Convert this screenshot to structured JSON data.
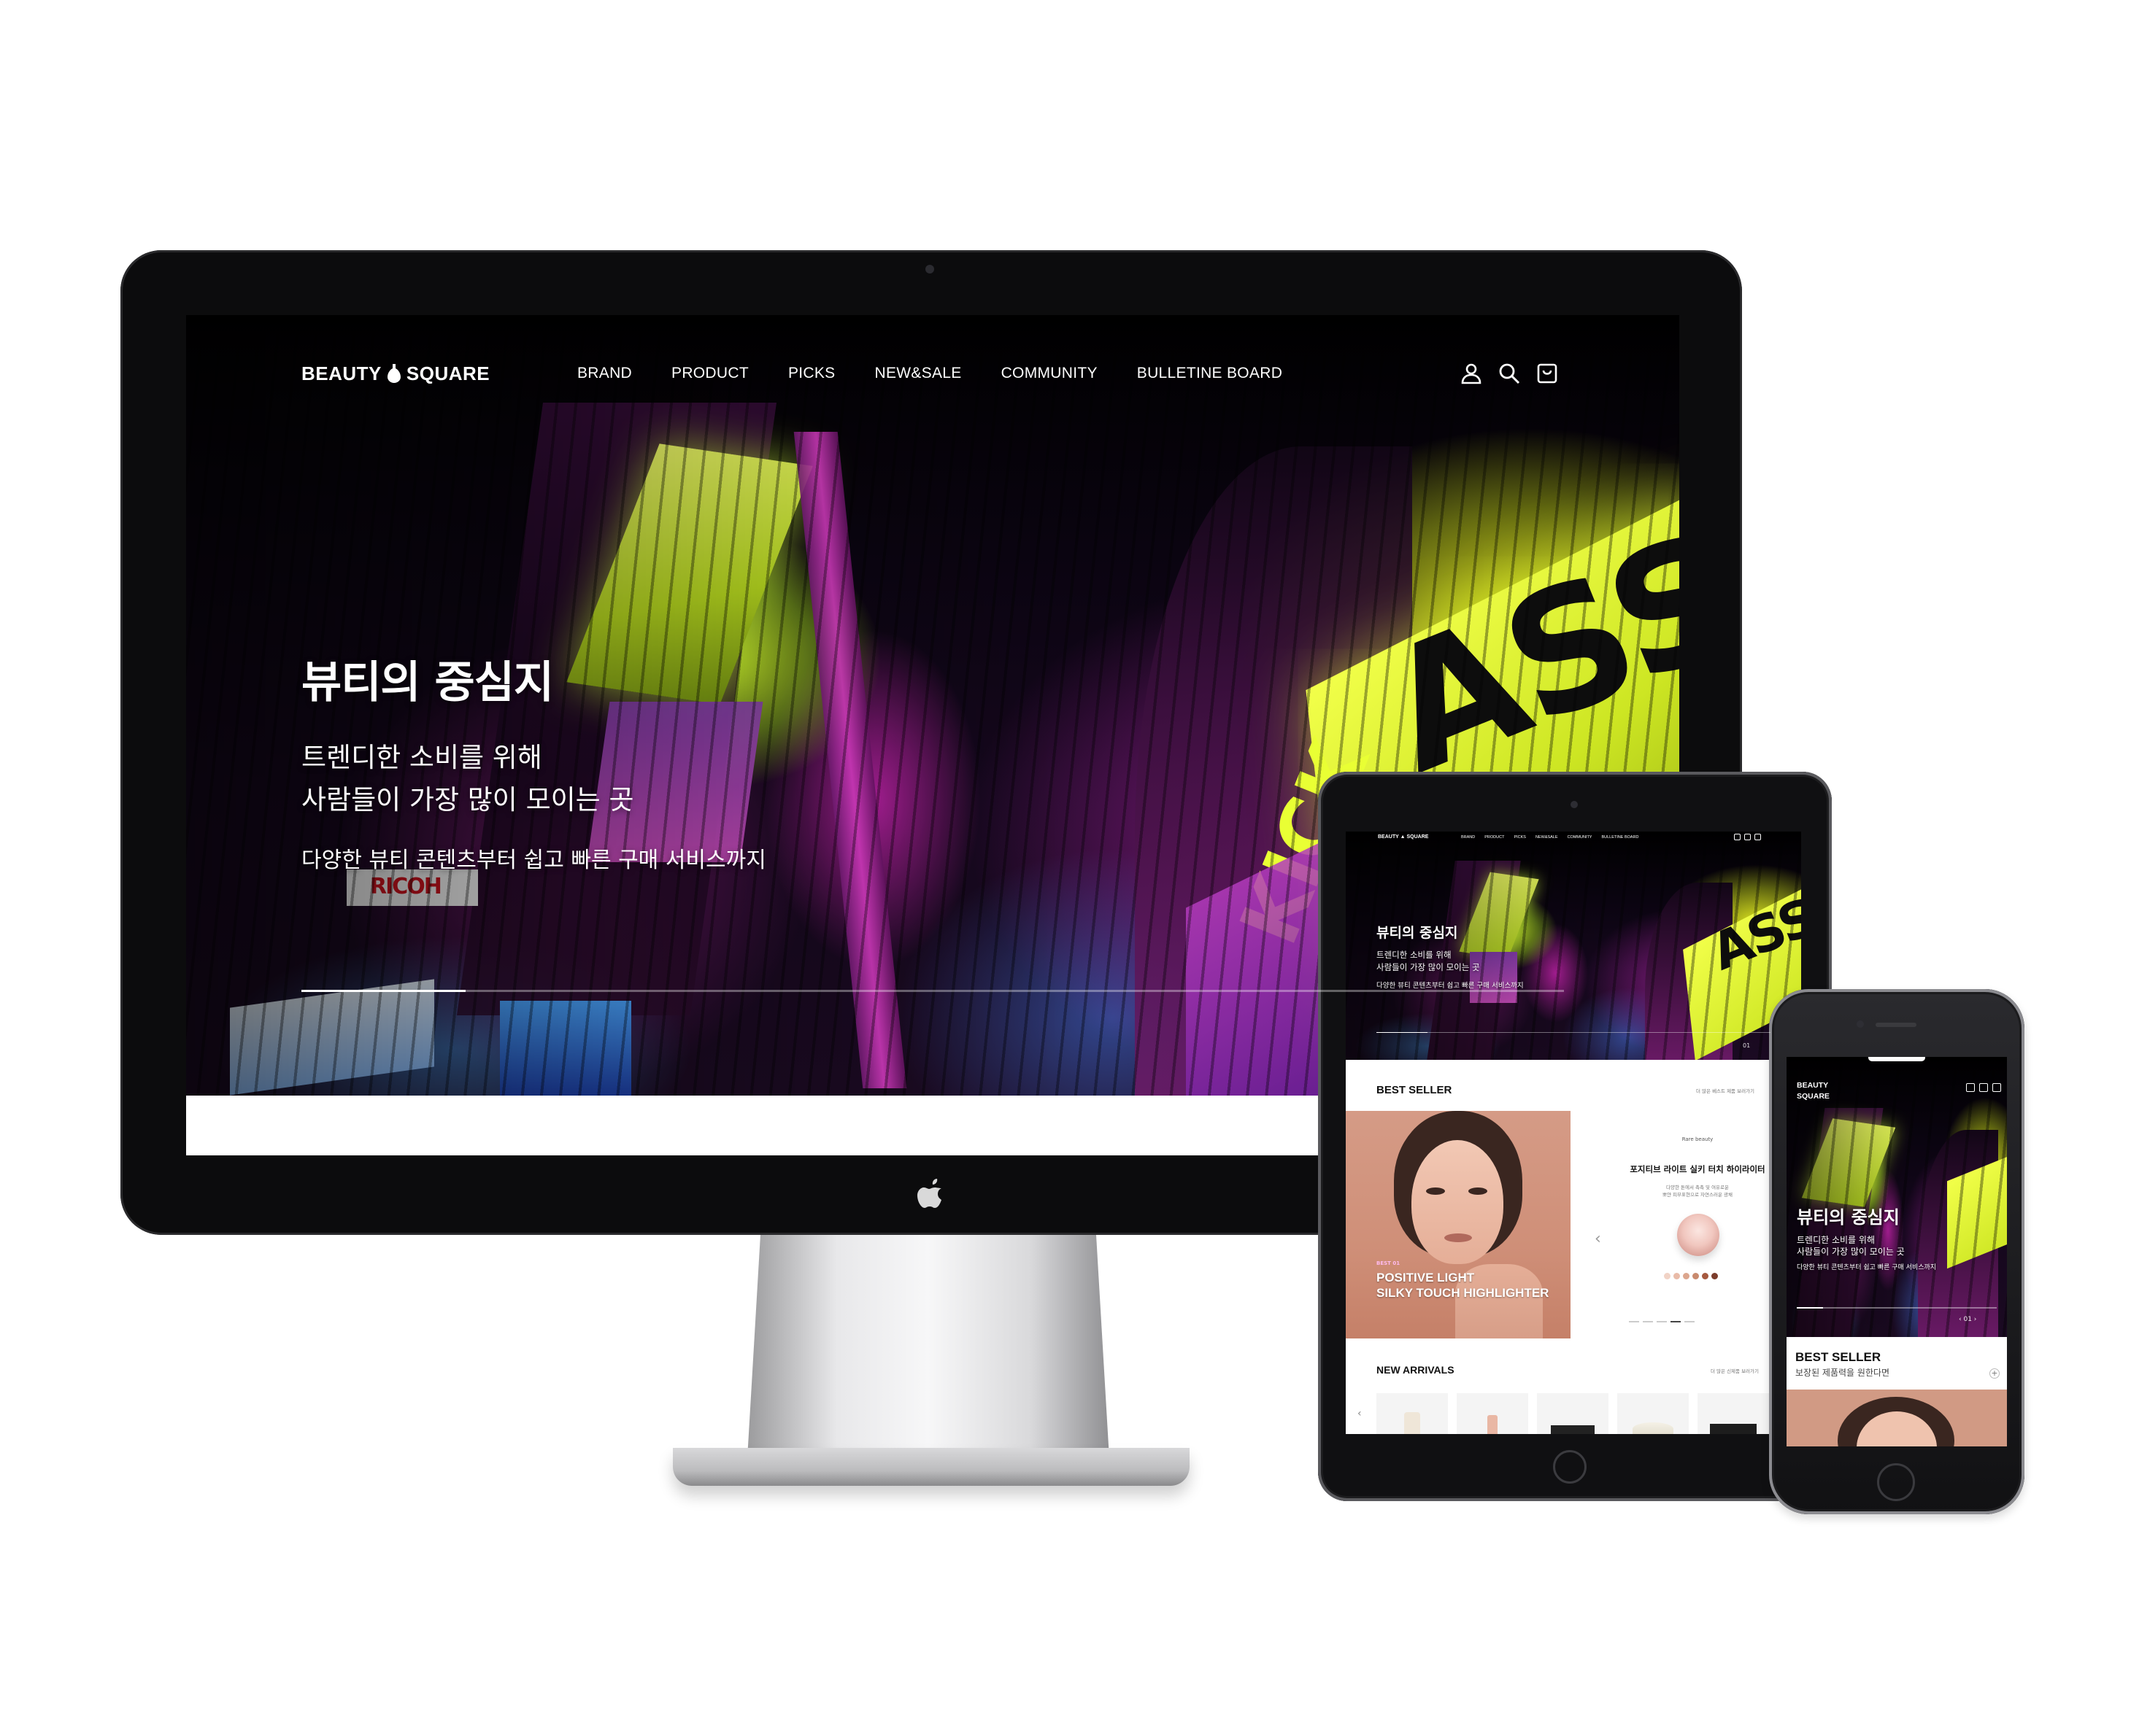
{
  "brand": {
    "name_left": "BEAUTY",
    "name_right": "SQUARE"
  },
  "nav": {
    "items": [
      "BRAND",
      "PRODUCT",
      "PICKS",
      "NEW&SALE",
      "COMMUNITY",
      "BULLETINE BOARD"
    ],
    "icons": [
      "user-icon",
      "search-icon",
      "cart-icon"
    ]
  },
  "hero": {
    "title": "뷰티의 중심지",
    "subtitle_line1": "트렌디한 소비를 위해",
    "subtitle_line2": "사람들이 가장 많이 모이는 곳",
    "description": "다양한 뷰티 콘텐츠부터 쉽고 빠른 구매 서비스까지",
    "progress": 0.13,
    "page_indicator": "01"
  },
  "best_seller": {
    "title": "BEST SELLER",
    "more": "더 많은 베스트 제품 보러가기",
    "mobile_subtitle": "보장된 제품력을 원한다면",
    "photo_label": "BEST 01",
    "photo_caption_line1": "POSITIVE LIGHT",
    "photo_caption_line2": "SILKY TOUCH HIGHLIGHTER",
    "product_brand": "Rare beauty",
    "product_name": "포지티브 라이트 실키 터치 하이라이터",
    "product_desc_line1": "다양한 톤에서 촉촉 및 여유로운",
    "product_desc_line2": "뽀얀 피부표현으로 자연스러운 광채",
    "swatch_colors": [
      "#f1d3c6",
      "#e9bba8",
      "#dca68e",
      "#c98a6e",
      "#a6593f",
      "#7c3d2c"
    ],
    "active_dot": 3
  },
  "new_arrivals": {
    "title": "NEW ARRIVALS",
    "more": "더 많은 신제품 보러가기"
  },
  "colors": {
    "accent_pink": "#d63ab8",
    "accent_lime": "#d8ef2a",
    "photo_bg": "#d29a84"
  }
}
